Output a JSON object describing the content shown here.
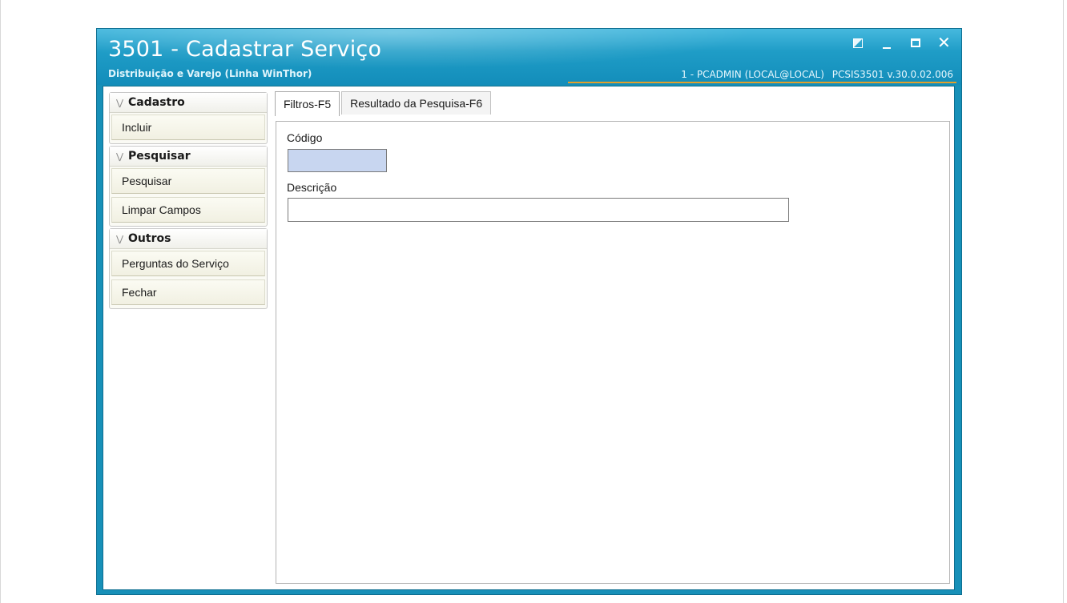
{
  "window": {
    "title": "3501 - Cadastrar Serviço",
    "subtitle": "Distribuição e Varejo (Linha WinThor)",
    "user_info": "1 - PCADMIN (LOCAL@LOCAL)",
    "program_version": "PCSIS3501  v.30.0.02.006",
    "close_symbol": "✕"
  },
  "colors": {
    "titlebar": "#1f9dc7",
    "accent_line": "#e3a02a",
    "codigo_field_bg": "#c8d6f0"
  },
  "sidebar": {
    "groups": [
      {
        "label": "Cadastro",
        "items": [
          "Incluir"
        ]
      },
      {
        "label": "Pesquisar",
        "items": [
          "Pesquisar",
          "Limpar Campos"
        ]
      },
      {
        "label": "Outros",
        "items": [
          "Perguntas do Serviço",
          "Fechar"
        ]
      }
    ]
  },
  "tabs": [
    "Filtros-F5",
    "Resultado da Pesquisa-F6"
  ],
  "form": {
    "codigo_label": "Código",
    "codigo_value": "",
    "descricao_label": "Descrição",
    "descricao_value": ""
  }
}
